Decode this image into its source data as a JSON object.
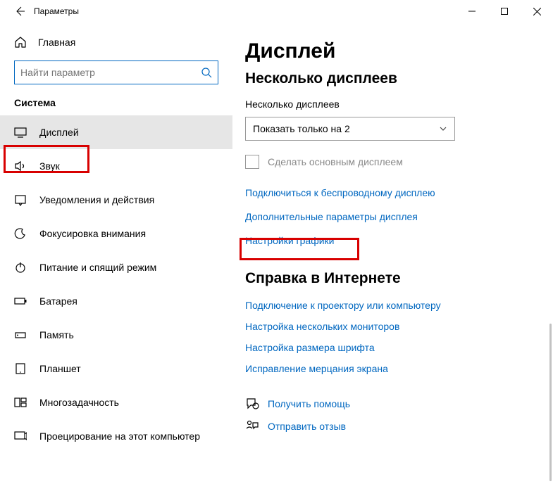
{
  "window": {
    "title": "Параметры"
  },
  "sidebar": {
    "home": "Главная",
    "search_placeholder": "Найти параметр",
    "category": "Система",
    "items": [
      {
        "label": "Дисплей"
      },
      {
        "label": "Звук"
      },
      {
        "label": "Уведомления и действия"
      },
      {
        "label": "Фокусировка внимания"
      },
      {
        "label": "Питание и спящий режим"
      },
      {
        "label": "Батарея"
      },
      {
        "label": "Память"
      },
      {
        "label": "Планшет"
      },
      {
        "label": "Многозадачность"
      },
      {
        "label": "Проецирование на этот компьютер"
      }
    ]
  },
  "main": {
    "title": "Дисплей",
    "section1_title": "Несколько дисплеев",
    "dropdown_label": "Несколько дисплеев",
    "dropdown_value": "Показать только на 2",
    "checkbox_label": "Сделать основным дисплеем",
    "links": [
      "Подключиться к беспроводному дисплею",
      "Дополнительные параметры дисплея",
      "Настройки графики"
    ],
    "help_title": "Справка в Интернете",
    "help_links": [
      "Подключение к проектору или компьютеру",
      "Настройка нескольких мониторов",
      "Настройка размера шрифта",
      "Исправление мерцания экрана"
    ],
    "footer_help": "Получить помощь",
    "footer_feedback": "Отправить отзыв"
  }
}
